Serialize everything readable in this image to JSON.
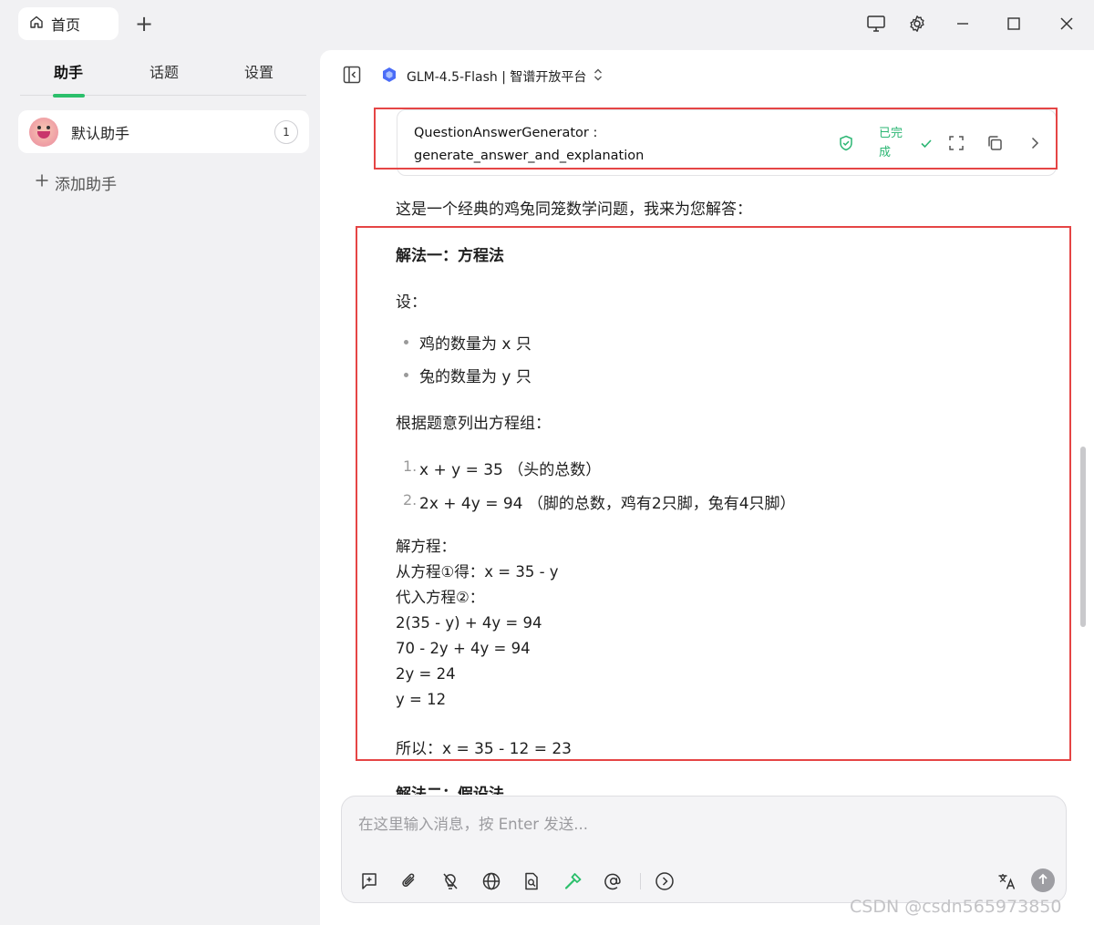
{
  "titlebar": {
    "home_tab_label": "首页",
    "new_tab": "+"
  },
  "sidebar": {
    "tabs": [
      {
        "label": "助手",
        "active": true
      },
      {
        "label": "话题",
        "active": false
      },
      {
        "label": "设置",
        "active": false
      }
    ],
    "assistant": {
      "name": "默认助手",
      "count": "1"
    },
    "add_assistant_label": "添加助手"
  },
  "main": {
    "model_label": "GLM-4.5-Flash | 智谱开放平台",
    "tool_call": {
      "name_line1": "QuestionAnswerGenerator :",
      "name_line2": "generate_answer_and_explanation",
      "status": "已完成"
    },
    "message": {
      "intro": "这是一个经典的鸡兔同笼数学问题，我来为您解答：",
      "method1_title": "解法一：方程法",
      "let_label": "设：",
      "bullets": [
        "鸡的数量为 x 只",
        "兔的数量为 y 只"
      ],
      "equations_intro": "根据题意列出方程组：",
      "equations": [
        {
          "num": "1.",
          "text": "x + y = 35 （头的总数）"
        },
        {
          "num": "2.",
          "text": "2x + 4y = 94 （脚的总数，鸡有2只脚，兔有4只脚）"
        }
      ],
      "solve_lines": [
        "解方程：",
        "从方程①得：x = 35 - y",
        "代入方程②：",
        "2(35 - y) + 4y = 94",
        "70 - 2y + 4y = 94",
        "2y = 24",
        "y = 12"
      ],
      "conclusion": "所以：x = 35 - 12 = 23",
      "method2_title": "解法二：假设法"
    }
  },
  "composer": {
    "placeholder": "在这里输入消息，按 Enter 发送..."
  },
  "watermark": "CSDN @csdn565973850",
  "colors": {
    "accent_green": "#2bbf6b",
    "highlight_red": "#e54545"
  }
}
